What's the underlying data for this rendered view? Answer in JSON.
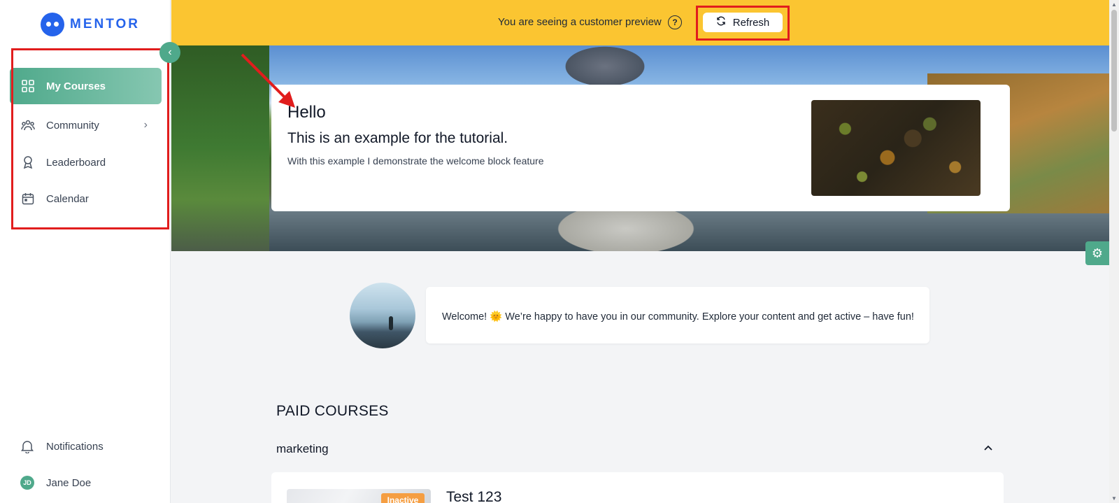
{
  "brand": {
    "name": "MENTOR"
  },
  "sidebar": {
    "items": [
      {
        "label": "My Courses",
        "icon": "grid-icon",
        "active": true
      },
      {
        "label": "Community",
        "icon": "users-icon"
      },
      {
        "label": "Leaderboard",
        "icon": "award-icon"
      },
      {
        "label": "Calendar",
        "icon": "calendar-icon"
      }
    ],
    "bottom": [
      {
        "label": "Notifications",
        "icon": "bell-icon"
      },
      {
        "label": "Jane Doe",
        "initials": "JD"
      }
    ]
  },
  "preview": {
    "text": "You are seeing a customer preview",
    "help": "?",
    "refresh_label": "Refresh"
  },
  "hero": {
    "title": "Hello",
    "subtitle": "This is an example for the tutorial.",
    "description": "With this example I demonstrate the welcome block feature"
  },
  "welcome": {
    "text": "Welcome! 🌞 We’re happy to have you in our community. Explore your content and get active – have fun!"
  },
  "courses": {
    "section_title": "PAID COURSES",
    "groups": [
      {
        "name": "marketing",
        "items": [
          {
            "title": "Test 123",
            "badge": "Inactive"
          }
        ]
      }
    ]
  },
  "colors": {
    "accent": "#4fa98b",
    "brand": "#2563eb",
    "banner": "#fbc531",
    "annotation": "#e11d1d",
    "badge": "#f59e42"
  }
}
